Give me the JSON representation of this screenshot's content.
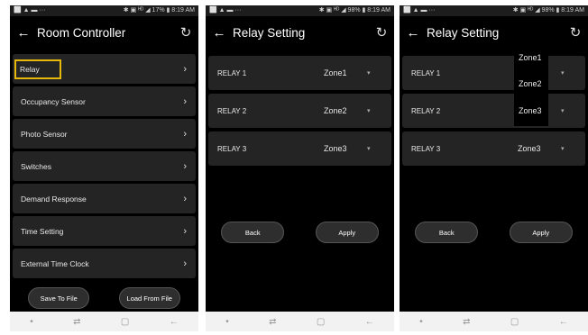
{
  "status": {
    "left": "⬜ ▲ ▬ ···",
    "right_1": "✱ ▣ ᴴᴰ ◢ 17% ▮ 8:19 AM",
    "right_2": "✱ ▣ ᴴᴰ ◢ 98% ▮ 8:19 AM",
    "right_3": "✱ ▣ ᴴᴰ ◢ 98% ▮ 8:19 AM"
  },
  "screen1": {
    "title": "Room Controller",
    "menu": [
      "Relay",
      "Occupancy Sensor",
      "Photo Sensor",
      "Switches",
      "Demand Response",
      "Time Setting",
      "External Time Clock"
    ],
    "save_label": "Save To File",
    "load_label": "Load From File"
  },
  "screen2": {
    "title": "Relay Setting",
    "relays": [
      {
        "name": "RELAY 1",
        "zone": "Zone1"
      },
      {
        "name": "RELAY 2",
        "zone": "Zone2"
      },
      {
        "name": "RELAY 3",
        "zone": "Zone3"
      }
    ],
    "back_label": "Back",
    "apply_label": "Apply"
  },
  "screen3": {
    "title": "Relay Setting",
    "relays": [
      {
        "name": "RELAY 1"
      },
      {
        "name": "RELAY 2"
      },
      {
        "name": "RELAY 3",
        "zone": "Zone3"
      }
    ],
    "dropdown_options": [
      "Zone1",
      "Zone2",
      "Zone3"
    ],
    "back_label": "Back",
    "apply_label": "Apply"
  },
  "icons": {
    "back": "←",
    "refresh": "↻",
    "chevron": "›",
    "caret": "▾",
    "nav_dot": "•",
    "nav_recent": "⇄",
    "nav_home": "▢",
    "nav_back": "←"
  },
  "colors": {
    "highlight": "#e5b80b",
    "row_bg": "#242424"
  }
}
